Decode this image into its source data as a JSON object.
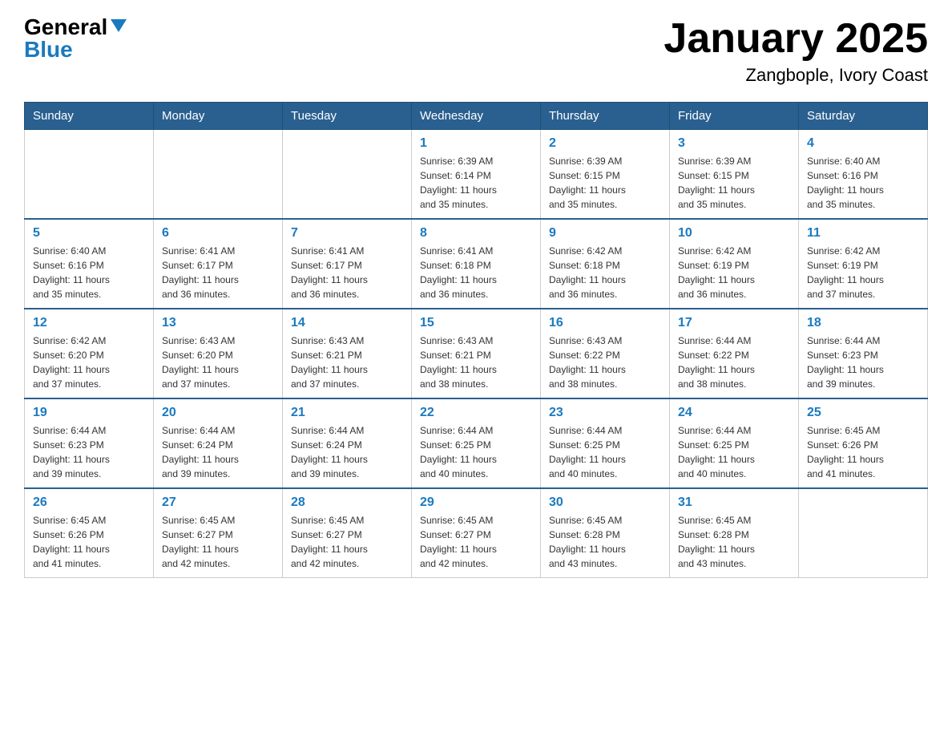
{
  "header": {
    "logo_text": "General",
    "logo_blue": "Blue",
    "title": "January 2025",
    "subtitle": "Zangbople, Ivory Coast"
  },
  "weekdays": [
    "Sunday",
    "Monday",
    "Tuesday",
    "Wednesday",
    "Thursday",
    "Friday",
    "Saturday"
  ],
  "weeks": [
    [
      {
        "day": "",
        "info": ""
      },
      {
        "day": "",
        "info": ""
      },
      {
        "day": "",
        "info": ""
      },
      {
        "day": "1",
        "info": "Sunrise: 6:39 AM\nSunset: 6:14 PM\nDaylight: 11 hours\nand 35 minutes."
      },
      {
        "day": "2",
        "info": "Sunrise: 6:39 AM\nSunset: 6:15 PM\nDaylight: 11 hours\nand 35 minutes."
      },
      {
        "day": "3",
        "info": "Sunrise: 6:39 AM\nSunset: 6:15 PM\nDaylight: 11 hours\nand 35 minutes."
      },
      {
        "day": "4",
        "info": "Sunrise: 6:40 AM\nSunset: 6:16 PM\nDaylight: 11 hours\nand 35 minutes."
      }
    ],
    [
      {
        "day": "5",
        "info": "Sunrise: 6:40 AM\nSunset: 6:16 PM\nDaylight: 11 hours\nand 35 minutes."
      },
      {
        "day": "6",
        "info": "Sunrise: 6:41 AM\nSunset: 6:17 PM\nDaylight: 11 hours\nand 36 minutes."
      },
      {
        "day": "7",
        "info": "Sunrise: 6:41 AM\nSunset: 6:17 PM\nDaylight: 11 hours\nand 36 minutes."
      },
      {
        "day": "8",
        "info": "Sunrise: 6:41 AM\nSunset: 6:18 PM\nDaylight: 11 hours\nand 36 minutes."
      },
      {
        "day": "9",
        "info": "Sunrise: 6:42 AM\nSunset: 6:18 PM\nDaylight: 11 hours\nand 36 minutes."
      },
      {
        "day": "10",
        "info": "Sunrise: 6:42 AM\nSunset: 6:19 PM\nDaylight: 11 hours\nand 36 minutes."
      },
      {
        "day": "11",
        "info": "Sunrise: 6:42 AM\nSunset: 6:19 PM\nDaylight: 11 hours\nand 37 minutes."
      }
    ],
    [
      {
        "day": "12",
        "info": "Sunrise: 6:42 AM\nSunset: 6:20 PM\nDaylight: 11 hours\nand 37 minutes."
      },
      {
        "day": "13",
        "info": "Sunrise: 6:43 AM\nSunset: 6:20 PM\nDaylight: 11 hours\nand 37 minutes."
      },
      {
        "day": "14",
        "info": "Sunrise: 6:43 AM\nSunset: 6:21 PM\nDaylight: 11 hours\nand 37 minutes."
      },
      {
        "day": "15",
        "info": "Sunrise: 6:43 AM\nSunset: 6:21 PM\nDaylight: 11 hours\nand 38 minutes."
      },
      {
        "day": "16",
        "info": "Sunrise: 6:43 AM\nSunset: 6:22 PM\nDaylight: 11 hours\nand 38 minutes."
      },
      {
        "day": "17",
        "info": "Sunrise: 6:44 AM\nSunset: 6:22 PM\nDaylight: 11 hours\nand 38 minutes."
      },
      {
        "day": "18",
        "info": "Sunrise: 6:44 AM\nSunset: 6:23 PM\nDaylight: 11 hours\nand 39 minutes."
      }
    ],
    [
      {
        "day": "19",
        "info": "Sunrise: 6:44 AM\nSunset: 6:23 PM\nDaylight: 11 hours\nand 39 minutes."
      },
      {
        "day": "20",
        "info": "Sunrise: 6:44 AM\nSunset: 6:24 PM\nDaylight: 11 hours\nand 39 minutes."
      },
      {
        "day": "21",
        "info": "Sunrise: 6:44 AM\nSunset: 6:24 PM\nDaylight: 11 hours\nand 39 minutes."
      },
      {
        "day": "22",
        "info": "Sunrise: 6:44 AM\nSunset: 6:25 PM\nDaylight: 11 hours\nand 40 minutes."
      },
      {
        "day": "23",
        "info": "Sunrise: 6:44 AM\nSunset: 6:25 PM\nDaylight: 11 hours\nand 40 minutes."
      },
      {
        "day": "24",
        "info": "Sunrise: 6:44 AM\nSunset: 6:25 PM\nDaylight: 11 hours\nand 40 minutes."
      },
      {
        "day": "25",
        "info": "Sunrise: 6:45 AM\nSunset: 6:26 PM\nDaylight: 11 hours\nand 41 minutes."
      }
    ],
    [
      {
        "day": "26",
        "info": "Sunrise: 6:45 AM\nSunset: 6:26 PM\nDaylight: 11 hours\nand 41 minutes."
      },
      {
        "day": "27",
        "info": "Sunrise: 6:45 AM\nSunset: 6:27 PM\nDaylight: 11 hours\nand 42 minutes."
      },
      {
        "day": "28",
        "info": "Sunrise: 6:45 AM\nSunset: 6:27 PM\nDaylight: 11 hours\nand 42 minutes."
      },
      {
        "day": "29",
        "info": "Sunrise: 6:45 AM\nSunset: 6:27 PM\nDaylight: 11 hours\nand 42 minutes."
      },
      {
        "day": "30",
        "info": "Sunrise: 6:45 AM\nSunset: 6:28 PM\nDaylight: 11 hours\nand 43 minutes."
      },
      {
        "day": "31",
        "info": "Sunrise: 6:45 AM\nSunset: 6:28 PM\nDaylight: 11 hours\nand 43 minutes."
      },
      {
        "day": "",
        "info": ""
      }
    ]
  ]
}
